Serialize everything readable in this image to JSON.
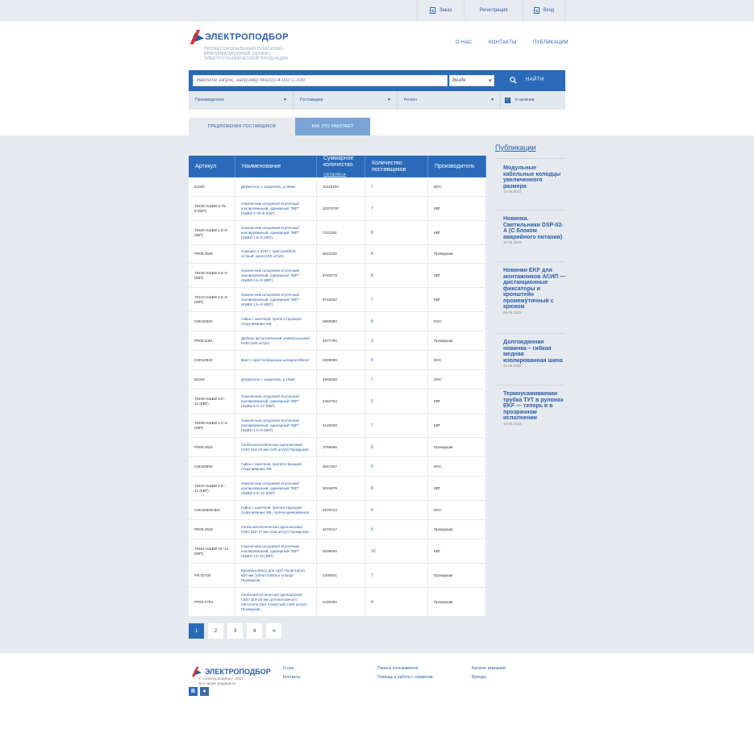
{
  "topbar": {
    "order": "Заказ",
    "register": "Регистрация",
    "login": "Вход"
  },
  "logo": {
    "name": "ЭЛЕКТРОПОДБОР",
    "tagline": "ПРОФЕССИОНАЛЬНЫЙ ПОИСКОВО-ИНФОРМАЦИОННЫЙ СЕРВИС ЭЛЕКТРОТЕХНИЧЕСКОЙ ПРОДУКЦИИ"
  },
  "nav": {
    "about": "О НАС",
    "contacts": "КОНТАКТЫ",
    "publications": "ПУБЛИКАЦИИ"
  },
  "search": {
    "placeholder": "Введите запрос, например МАD10-4-032-С-030",
    "scope": "Везде",
    "button": "НАЙТИ"
  },
  "filters": {
    "manufacturers": "Производители",
    "suppliers": "Поставщики",
    "region": "Регион",
    "in_stock": "в наличии"
  },
  "tabs": {
    "offers": "ПРЕДЛОЖЕНИЯ ПОСТАВЩИКОВ",
    "how": "КАК ЭТО РАБОТАЕТ"
  },
  "table": {
    "headers": {
      "article": "Артикул",
      "name": "Наименование",
      "qty": "Суммарное количество",
      "qty_sort": "сортировка▲",
      "suppliers": "Количество поставщиков",
      "maker": "Производитель"
    },
    "rows": [
      {
        "article": "51020",
        "name": "Держатель с защелкой, д 20мм",
        "qty": "10119194",
        "suppliers": "7",
        "maker": "DKC"
      },
      {
        "article": "79436 НШВИ 0.75–8 (КВТ)",
        "name": "Наконечник штыревой втулочный изолированный, одинарный \"КВТ\" НШВИ 0.75–8 (КВТ)",
        "qty": "10070797",
        "suppliers": "7",
        "maker": "КВТ"
      },
      {
        "article": "79440 НШВИ 1.5–8 (КВТ)",
        "name": "Наконечник штыревой втулочный изолированный, одинарный \"КВТ\" НШВИ 1.5–8 (КВТ)",
        "qty": "7431192",
        "suppliers": "8",
        "maker": "КВТ"
      },
      {
        "article": "PR08.3626",
        "name": "Саморез 4,2х32 с прессшайбой, острый, цинк (100 шт/уп)",
        "qty": "6022100",
        "suppliers": "4",
        "maker": "Промрукав"
      },
      {
        "article": "79435 НШВИ 0.5–8 (КВТ)",
        "name": "Наконечник штыревой втулочный изолированный, одинарный \"КВТ\" НШВИ 0.5–8 (КВТ)",
        "qty": "5763179",
        "suppliers": "8",
        "maker": "КВТ"
      },
      {
        "article": "79443 НШВИ 2.5–8 (КВТ)",
        "name": "Наконечник штыревой втулочный изолированный, одинарный \"КВТ\" НШВИ 2.5–8 (КВТ)",
        "qty": "5742032",
        "suppliers": "7",
        "maker": "КВТ"
      },
      {
        "article": "CM100600",
        "name": "Гайка с насечкой, препятствующей откручиванию М6",
        "qty": "5659080",
        "suppliers": "8",
        "maker": "DKC"
      },
      {
        "article": "PR08.3481",
        "name": "Дюбель металлический универсальный 5х30 (100 шт/уп)",
        "qty": "4877700",
        "suppliers": "3",
        "maker": "Промрукав"
      },
      {
        "article": "CM010610",
        "name": "Винт с крестообразным шлицем М6х10",
        "qty": "4599069",
        "suppliers": "9",
        "maker": "DKC"
      },
      {
        "article": "51016",
        "name": "Держатель с защелкой, д 16мм",
        "qty": "4565638",
        "suppliers": "7",
        "maker": "DKC"
      },
      {
        "article": "79449 НШВИ 6.0–12 (КВТ)",
        "name": "Наконечник штыревой втулочный изолированный, одинарный \"КВТ\" НШВИ 6.0–12 (КВТ)",
        "qty": "4464704",
        "suppliers": "9",
        "maker": "КВТ"
      },
      {
        "article": "79438 НШВИ 1.0–8 (КВТ)",
        "name": "Наконечник штыревой втулочный изолированный, одинарный \"КВТ\" НШВИ 1.0–8 (КВТ)",
        "qty": "4140036",
        "suppliers": "7",
        "maker": "КВТ"
      },
      {
        "article": "PR00.2534",
        "name": "Скоба металлическая однолаповая СМО d19-20 мм (100 шт/уп) Промрукав",
        "qty": "3755595",
        "suppliers": "6",
        "maker": "Промрукав"
      },
      {
        "article": "CM100800",
        "name": "Гайка с насечкой, препятствующей откручиванию М8",
        "qty": "3647347",
        "suppliers": "9",
        "maker": "DKC"
      },
      {
        "article": "79444 НШВИ 2.5–12 (КВТ)",
        "name": "Наконечник штыревой втулочный изолированный, одинарный \"КВТ\" НШВИ 2.5–12 (КВТ)",
        "qty": "3024979",
        "suppliers": "8",
        "maker": "КВТ"
      },
      {
        "article": "CM100600HDZ",
        "name": "Гайка с насечкой, препятствующей откручиванию М6, горячеоцинкованная",
        "qty": "2979723",
        "suppliers": "4",
        "maker": "DKC"
      },
      {
        "article": "PR00.2533",
        "name": "Скоба металлическая однолаповая СМО d16-17 мм (100 шт/уп) Промрукав",
        "qty": "2670217",
        "suppliers": "6",
        "maker": "Промрукав"
      },
      {
        "article": "79451 НШВИ 10–12 (КВТ)",
        "name": "Наконечник штыревой втулочный изолированный, одинарный \"КВТ\" НШВИ 10–12 (КВТ)",
        "qty": "2539500",
        "suppliers": "10",
        "maker": "КВТ"
      },
      {
        "article": "PR.02720",
        "name": "Крепёж-клипса для труб Полистирол d20 мм (100шт/1500шт уп/кор) Промрукав",
        "qty": "2400921",
        "suppliers": "7",
        "maker": "Промрукав"
      },
      {
        "article": "PR00.2754",
        "name": "Скоба металлическая однолаповая СМО d19-20 мм для монтажного пистолета (без отверстий) (100 шт/уп) Промрукав",
        "qty": "2425400",
        "suppliers": "4",
        "maker": "Промрукав"
      }
    ]
  },
  "pager": [
    "1",
    "2",
    "3",
    "4",
    "➔"
  ],
  "publications": {
    "title": "Публикации",
    "items": [
      {
        "title": "Модульные кабельные колодцы увеличенного размера",
        "date": "14.06.2022"
      },
      {
        "title": "Новинка. Светильники DSP-02-А (С блоком аварийного питания)",
        "date": "10.06.2022"
      },
      {
        "title": "Новинки EKF для монтажников АСИП — дистанционные фиксаторы и кронштейн промежуточный с крюком",
        "date": "06.06.2022"
      },
      {
        "title": "Долгожданная новинка – гибкая медная изолированная шина",
        "date": "31.05.2022"
      },
      {
        "title": "Термоусаживаемая трубка ТУТ в рулонах EKF — теперь и в прозрачном исполнении",
        "date": "13.05.2022"
      }
    ]
  },
  "footer": {
    "logo": "ЭЛЕКТРОПОДБОР",
    "copyright": "© «Электроподбор», 2022",
    "rights": "Все права защищены",
    "links": {
      "about": "О нас",
      "contacts": "Контакты",
      "panel": "Панель пользователя",
      "help": "Помощь в работе с сервисом",
      "catalog": "Каталог компаний",
      "brands": "Бренды"
    },
    "social": [
      "В",
      "♦"
    ]
  }
}
